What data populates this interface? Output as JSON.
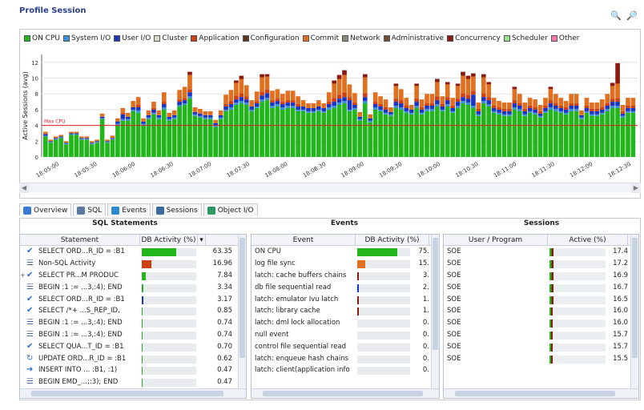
{
  "title": "Profile Session",
  "toolbar": {
    "zoom_in_icon": "zoom-in-icon",
    "zoom_out_icon": "zoom-out-icon"
  },
  "legend": [
    {
      "label": "ON CPU",
      "color": "#22b51c"
    },
    {
      "label": "System I/O",
      "color": "#3d8fd6"
    },
    {
      "label": "User I/O",
      "color": "#1a35c4"
    },
    {
      "label": "Cluster",
      "color": "#d8d8d0"
    },
    {
      "label": "Application",
      "color": "#d04010"
    },
    {
      "label": "Configuration",
      "color": "#5a3a1a"
    },
    {
      "label": "Commit",
      "color": "#e07020"
    },
    {
      "label": "Network",
      "color": "#8a8a80"
    },
    {
      "label": "Administrative",
      "color": "#6a5030"
    },
    {
      "label": "Concurrency",
      "color": "#8a1a10"
    },
    {
      "label": "Scheduler",
      "color": "#9ae090"
    },
    {
      "label": "Other",
      "color": "#f07ab0"
    }
  ],
  "chart_data": {
    "type": "bar",
    "stacked": true,
    "ylabel": "Active Sessions (avg)",
    "ylim": [
      0,
      13
    ],
    "yticks": [
      0,
      2,
      4,
      6,
      8,
      10,
      12
    ],
    "reference_line": {
      "label": "Max CPU",
      "value": 4
    },
    "xticks": [
      "18:05:00",
      "18:05:30",
      "18:06:00",
      "18:06:30",
      "18:07:00",
      "18:07:30",
      "18:08:00",
      "18:08:30",
      "18:09:00",
      "18:09:30",
      "18:10:00",
      "18:10:30",
      "18:11:00",
      "18:11:30",
      "18:12:00",
      "18:12:30"
    ],
    "series": [
      {
        "name": "ON CPU",
        "color": "#22b51c",
        "values": [
          2.6,
          1.8,
          2.2,
          2.4,
          1.6,
          2.8,
          2.8,
          2.2,
          2.2,
          1.6,
          1.8,
          4.8,
          1.8,
          2.2,
          4.0,
          4.6,
          4.6,
          5.8,
          5.6,
          4.0,
          4.8,
          5.4,
          4.8,
          6.0,
          4.6,
          4.8,
          6.4,
          6.6,
          7.4,
          5.2,
          5.0,
          4.8,
          4.8,
          3.8,
          4.8,
          5.8,
          6.0,
          6.6,
          6.8,
          6.6,
          5.8,
          6.2,
          7.0,
          7.2,
          6.2,
          6.4,
          6.0,
          6.2,
          6.2,
          5.8,
          5.8,
          5.6,
          5.6,
          5.8,
          5.6,
          6.0,
          6.2,
          6.6,
          6.8,
          5.8,
          6.0,
          4.6,
          6.8,
          4.4,
          6.0,
          5.8,
          5.4,
          5.2,
          6.2,
          6.0,
          5.6,
          5.4,
          6.2,
          5.4,
          5.8,
          5.8,
          6.4,
          5.8,
          6.4,
          5.6,
          6.2,
          6.8,
          6.6,
          6.2,
          5.2,
          6.8,
          6.4,
          5.6,
          5.4,
          5.2,
          5.2,
          6.0,
          5.8,
          5.2,
          5.6,
          5.4,
          5.0,
          5.6,
          6.0,
          5.8,
          5.6,
          5.4,
          5.8,
          5.8,
          4.8,
          5.6,
          5.2,
          5.2,
          5.4,
          5.8,
          6.2,
          6.2,
          5.0,
          5.6,
          5.6
        ]
      },
      {
        "name": "System I/O",
        "color": "#3d8fd6",
        "values": [
          0.1,
          0.1,
          0.1,
          0.1,
          0.1,
          0.1,
          0.1,
          0.1,
          0.1,
          0.1,
          0.1,
          0.1,
          0.1,
          0.1,
          0.2,
          0.2,
          0.2,
          0.2,
          0.3,
          0.2,
          0.2,
          0.2,
          0.2,
          0.3,
          0.2,
          0.2,
          0.2,
          0.2,
          0.3,
          0.2,
          0.2,
          0.2,
          0.2,
          0.2,
          0.2,
          0.2,
          0.3,
          0.3,
          0.3,
          0.3,
          0.2,
          0.2,
          0.3,
          0.3,
          0.3,
          0.3,
          0.3,
          0.3,
          0.3,
          0.2,
          0.2,
          0.2,
          0.2,
          0.2,
          0.2,
          0.3,
          0.3,
          0.3,
          0.3,
          0.2,
          0.2,
          0.2,
          0.3,
          0.2,
          0.3,
          0.2,
          0.2,
          0.2,
          0.3,
          0.3,
          0.2,
          0.2,
          0.3,
          0.2,
          0.3,
          0.3,
          0.3,
          0.2,
          0.3,
          0.2,
          0.3,
          0.3,
          0.3,
          0.3,
          0.2,
          0.3,
          0.3,
          0.2,
          0.2,
          0.2,
          0.2,
          0.3,
          0.3,
          0.2,
          0.2,
          0.2,
          0.2,
          0.2,
          0.3,
          0.3,
          0.2,
          0.2,
          0.3,
          0.3,
          0.2,
          0.2,
          0.2,
          0.2,
          0.2,
          0.3,
          0.3,
          0.3,
          0.2,
          0.2,
          0.2
        ]
      },
      {
        "name": "User I/O",
        "color": "#1a35c4",
        "values": [
          0.2,
          0.1,
          0.1,
          0.1,
          0.1,
          0.1,
          0.1,
          0.1,
          0.1,
          0.1,
          0.1,
          0.2,
          0.1,
          0.1,
          0.3,
          0.6,
          0.3,
          0.3,
          0.4,
          0.3,
          0.3,
          0.4,
          0.3,
          0.4,
          0.3,
          0.3,
          0.4,
          0.4,
          0.5,
          0.3,
          0.3,
          0.3,
          0.3,
          0.3,
          0.3,
          0.4,
          0.4,
          0.4,
          0.5,
          0.4,
          0.4,
          0.4,
          0.5,
          0.6,
          0.4,
          0.4,
          0.4,
          0.4,
          0.4,
          0.4,
          0.4,
          0.4,
          0.4,
          0.4,
          0.4,
          0.4,
          0.5,
          0.5,
          0.5,
          1.2,
          0.4,
          0.3,
          0.5,
          0.3,
          0.4,
          0.4,
          0.4,
          0.3,
          0.5,
          0.5,
          0.4,
          0.4,
          0.5,
          0.4,
          0.4,
          0.4,
          0.5,
          0.4,
          0.5,
          0.4,
          0.5,
          0.5,
          0.5,
          1.4,
          0.4,
          0.5,
          0.5,
          0.4,
          0.4,
          0.4,
          0.4,
          0.5,
          0.4,
          0.4,
          0.4,
          0.4,
          0.3,
          0.4,
          0.5,
          0.4,
          0.4,
          0.4,
          0.4,
          0.4,
          0.3,
          0.4,
          0.4,
          0.4,
          0.4,
          0.4,
          0.5,
          0.5,
          0.3,
          0.4,
          0.4
        ]
      },
      {
        "name": "Application",
        "color": "#d04010",
        "values": [
          0,
          0,
          0,
          0,
          0,
          0,
          0,
          0,
          0,
          0,
          0,
          0,
          0,
          0,
          0,
          0.2,
          0,
          0,
          0.3,
          0,
          0,
          0.2,
          0,
          0.3,
          0,
          0,
          0.3,
          0.3,
          0.4,
          0,
          0,
          0,
          0,
          0,
          0,
          0.3,
          0.4,
          0.5,
          0.5,
          0.4,
          0,
          0.3,
          0.5,
          0.5,
          0.3,
          0.3,
          0.3,
          0.3,
          0.3,
          0.3,
          0,
          0,
          0,
          0,
          0,
          0.3,
          0.5,
          0.5,
          0.6,
          0.4,
          0.3,
          0,
          0.5,
          0,
          0.3,
          0.3,
          0.3,
          0,
          0.4,
          0.4,
          0.3,
          0,
          0.4,
          0.3,
          0.3,
          0.3,
          0.5,
          0.3,
          0.4,
          0.3,
          0.4,
          0.5,
          0.5,
          0.5,
          0.3,
          0.5,
          0.4,
          0.3,
          0.3,
          0.3,
          0.3,
          0.4,
          0.3,
          0.3,
          0.3,
          0.3,
          0.3,
          0.3,
          0.4,
          0.3,
          0.3,
          0.3,
          0.3,
          0.3,
          0,
          0.3,
          0.3,
          0.3,
          0.3,
          0.3,
          0.4,
          0.5,
          0.3,
          0.3,
          0.3
        ]
      },
      {
        "name": "Commit",
        "color": "#e07020",
        "values": [
          0.3,
          0.2,
          0.2,
          0.2,
          0.2,
          0.2,
          0.2,
          0.2,
          0.2,
          0.2,
          0.2,
          0.4,
          0.2,
          0.3,
          0.4,
          0.6,
          0.5,
          0.8,
          1.0,
          0.4,
          0.6,
          0.8,
          0.6,
          1.2,
          0.5,
          0.6,
          1.2,
          1.4,
          1.8,
          0.6,
          0.6,
          0.5,
          0.5,
          0.4,
          0.6,
          1.2,
          1.4,
          1.6,
          1.8,
          1.4,
          0.8,
          1.2,
          1.8,
          1.6,
          1.2,
          1.2,
          1.0,
          1.2,
          1.2,
          1.0,
          0.8,
          0.6,
          0.6,
          0.8,
          0.6,
          1.2,
          1.8,
          2.0,
          2.2,
          1.6,
          1.2,
          0.6,
          2.0,
          0.5,
          1.2,
          1.0,
          1.0,
          0.6,
          1.6,
          1.4,
          1.0,
          0.6,
          1.6,
          1.0,
          1.2,
          1.2,
          1.8,
          1.0,
          1.6,
          1.0,
          1.6,
          2.2,
          2.0,
          1.8,
          0.8,
          2.0,
          1.6,
          1.0,
          0.8,
          0.8,
          0.8,
          1.4,
          1.2,
          0.8,
          1.0,
          1.0,
          0.8,
          1.0,
          1.4,
          1.2,
          1.0,
          0.8,
          1.2,
          1.2,
          0.6,
          1.0,
          0.8,
          0.8,
          1.0,
          1.2,
          1.6,
          1.8,
          0.8,
          1.0,
          1.0
        ]
      },
      {
        "name": "Concurrency",
        "color": "#8a1a10",
        "values": [
          0,
          0,
          0,
          0,
          0,
          0,
          0,
          0,
          0,
          0,
          0,
          0,
          0,
          0,
          0,
          0,
          0,
          0,
          0,
          0,
          0,
          0,
          0,
          0,
          0,
          0,
          0,
          0,
          0.4,
          0,
          0,
          0,
          0,
          0,
          0,
          0,
          0,
          0.3,
          0.4,
          0,
          0,
          0,
          0.4,
          0.3,
          0,
          0,
          0,
          0,
          0,
          0,
          0,
          0,
          0,
          0,
          0,
          0,
          0.4,
          0.5,
          0.6,
          0,
          0,
          0,
          0.4,
          0,
          0,
          0,
          0,
          0,
          0.3,
          0,
          0,
          0,
          0.3,
          0,
          0,
          0,
          0.4,
          0,
          0.3,
          0,
          0.3,
          0.5,
          0.4,
          0.4,
          0,
          0.4,
          0.3,
          0,
          0,
          0,
          0,
          0.3,
          0,
          0,
          0,
          0,
          0,
          0,
          0.3,
          0,
          0,
          0,
          0,
          0,
          0,
          0,
          0,
          0,
          0,
          0,
          0.4,
          2.6,
          0,
          0,
          0
        ]
      }
    ]
  },
  "tabs": [
    {
      "label": "Overview",
      "icon": "overview-icon"
    },
    {
      "label": "SQL",
      "icon": "sql-icon"
    },
    {
      "label": "Events",
      "icon": "events-icon"
    },
    {
      "label": "Sessions",
      "icon": "sessions-icon"
    },
    {
      "label": "Object I/O",
      "icon": "object-io-icon"
    }
  ],
  "sql_panel": {
    "title": "SQL Statements",
    "columns": [
      "Statement",
      "DB Activity (%)"
    ],
    "rows": [
      {
        "statement": "SELECT ORD...R_ID = :B1",
        "activity": "63.35",
        "fill": 0.6335,
        "color": "#22b51c",
        "icon": "check-icon",
        "expanded": false
      },
      {
        "statement": "Non-SQL Activity",
        "activity": "16.96",
        "fill": 0.1696,
        "color": "#d04010",
        "icon": "sql-doc-icon",
        "expanded": false
      },
      {
        "statement": "SELECT PR...M PRODUC",
        "activity": "7.84",
        "fill": 0.0784,
        "color": "#22b51c",
        "icon": "check-icon",
        "expanded": true
      },
      {
        "statement": "BEGIN :1 := ...3,:4); END",
        "activity": "3.34",
        "fill": 0.0334,
        "color": "#22b51c",
        "icon": "sql-doc-icon",
        "expanded": false
      },
      {
        "statement": "SELECT ORD...R_ID = :B1",
        "activity": "3.17",
        "fill": 0.0317,
        "color": "#1a35c4",
        "icon": "check-icon",
        "expanded": false
      },
      {
        "statement": "SELECT /*+ ...S_REP_ID,",
        "activity": "0.85",
        "fill": 0.0085,
        "color": "#22b51c",
        "icon": "check-icon",
        "expanded": false
      },
      {
        "statement": "BEGIN :1 := ...3,:4); END",
        "activity": "0.74",
        "fill": 0.0074,
        "color": "#22b51c",
        "icon": "sql-doc-icon",
        "expanded": false
      },
      {
        "statement": "BEGIN :1 := ...3,:4); END",
        "activity": "0.74",
        "fill": 0.0074,
        "color": "#22b51c",
        "icon": "sql-doc-icon",
        "expanded": false
      },
      {
        "statement": "SELECT QUA...T_ID = :B1",
        "activity": "0.70",
        "fill": 0.007,
        "color": "#22b51c",
        "icon": "check-icon",
        "expanded": false
      },
      {
        "statement": "UPDATE ORD...R_ID = :B1",
        "activity": "0.62",
        "fill": 0.0062,
        "color": "#22b51c",
        "icon": "update-icon",
        "expanded": false
      },
      {
        "statement": "INSERT INTO ... :B1, :1)",
        "activity": "0.47",
        "fill": 0.0047,
        "color": "#22b51c",
        "icon": "insert-icon",
        "expanded": false
      },
      {
        "statement": "BEGIN EMD_...;:3); END",
        "activity": "0.47",
        "fill": 0.0047,
        "color": "#22b51c",
        "icon": "sql-doc-icon",
        "expanded": false
      }
    ]
  },
  "events_panel": {
    "title": "Events",
    "columns": [
      "Event",
      "DB Activity (%)"
    ],
    "rows": [
      {
        "event": "ON CPU",
        "activity": "75.",
        "fill": 0.75,
        "color": "#22b51c"
      },
      {
        "event": "log file sync",
        "activity": "15.",
        "fill": 0.15,
        "color": "#e07020"
      },
      {
        "event": "latch: cache buffers chains",
        "activity": "3.",
        "fill": 0.03,
        "color": "#8a1a10"
      },
      {
        "event": "db file sequential read",
        "activity": "2.",
        "fill": 0.02,
        "color": "#1a35c4"
      },
      {
        "event": "latch: emulator Ivu latch",
        "activity": "1.",
        "fill": 0.01,
        "color": "#8a1a10"
      },
      {
        "event": "latch: library cache",
        "activity": "1.",
        "fill": 0.01,
        "color": "#8a1a10"
      },
      {
        "event": "latch: dml lock allocation",
        "activity": "0.",
        "fill": 0.0,
        "color": "#8a1a10"
      },
      {
        "event": "null event",
        "activity": "0.",
        "fill": 0.0,
        "color": "#8a8a80"
      },
      {
        "event": "control file sequential read",
        "activity": "0.",
        "fill": 0.0,
        "color": "#3d8fd6"
      },
      {
        "event": "latch: enqueue hash chains",
        "activity": "0.",
        "fill": 0.0,
        "color": "#8a1a10"
      },
      {
        "event": "latch: client(application info",
        "activity": "0.",
        "fill": 0.0,
        "color": "#8a1a10"
      }
    ]
  },
  "sessions_panel": {
    "title": "Sessions",
    "columns": [
      "User / Program",
      "Active (%)"
    ],
    "rows": [
      {
        "user": "SOE",
        "active": "17.4",
        "fill": 0.174
      },
      {
        "user": "SOE",
        "active": "17.2",
        "fill": 0.172
      },
      {
        "user": "SOE",
        "active": "16.9",
        "fill": 0.169
      },
      {
        "user": "SOE",
        "active": "16.7",
        "fill": 0.167
      },
      {
        "user": "SOE",
        "active": "16.5",
        "fill": 0.165
      },
      {
        "user": "SOE",
        "active": "16.0",
        "fill": 0.16
      },
      {
        "user": "SOE",
        "active": "16.0",
        "fill": 0.16
      },
      {
        "user": "SOE",
        "active": "15.7",
        "fill": 0.157
      },
      {
        "user": "SOE",
        "active": "15.7",
        "fill": 0.157
      },
      {
        "user": "SOE",
        "active": "15.5",
        "fill": 0.155
      }
    ]
  }
}
